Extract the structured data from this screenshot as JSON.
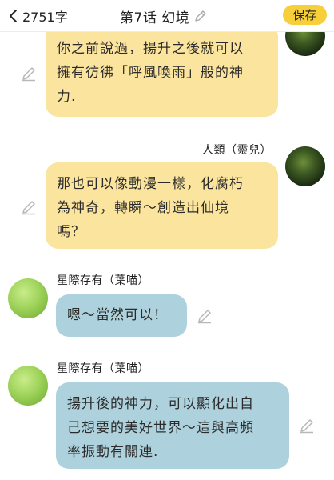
{
  "header": {
    "back_count": "2751字",
    "title": "第7话 幻境",
    "save_label": "保存"
  },
  "messages": [
    {
      "side": "right",
      "color": "yellow",
      "text_lines": [
        "你之前說過，揚升之後就可以",
        "擁有彷彿「呼風喚雨」般的神",
        "力."
      ]
    },
    {
      "side": "right",
      "color": "yellow",
      "sender": "人類（靈兒）",
      "text_lines": [
        "那也可以像動漫一樣，化腐朽",
        "為神奇，轉瞬～創造出仙境",
        "嗎？"
      ]
    },
    {
      "side": "left",
      "color": "blue",
      "sender": "星際存有（葉喵）",
      "text_lines": [
        "嗯～當然可以！"
      ]
    },
    {
      "side": "left",
      "color": "blue",
      "sender": "星際存有（葉喵）",
      "text_lines": [
        "揚升後的神力，可以顯化出自",
        "己想要的美好世界～這與高頻",
        "率振動有關連."
      ]
    }
  ],
  "icons": {
    "back": "chevron-left-icon",
    "title_edit": "pencil-icon",
    "bubble_edit": "pencil-icon"
  },
  "colors": {
    "save_button": "#f6cf3a",
    "user_bubble": "#fbe49d",
    "bot_bubble": "#aed2dd"
  }
}
